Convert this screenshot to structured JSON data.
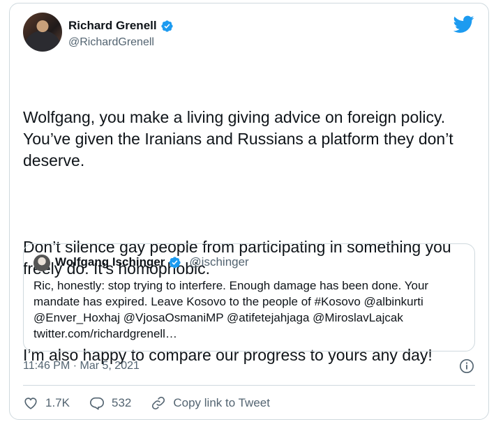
{
  "author": {
    "name": "Richard Grenell",
    "handle": "@RichardGrenell",
    "verified": true
  },
  "tweet": {
    "paragraphs": [
      "Wolfgang, you make a living giving advice on foreign policy. You’ve given the Iranians and Russians a platform they don’t deserve.",
      "Don’t silence gay people from participating in something you freely do. It’s homophobic.",
      "I’m also happy to compare our progress to yours any day!"
    ],
    "timestamp": "11:46 PM · Mar 5, 2021"
  },
  "quoted_tweet": {
    "name": "Wolfgang Ischinger",
    "handle": "@ischinger",
    "verified": true,
    "text": "Ric, honestly: stop trying to interfere. Enough damage has been done. Your mandate has expired. Leave Kosovo to the people of #Kosovo @albinkurti @Enver_Hoxhaj @VjosaOsmaniMP @atifetejahjaga @MiroslavLajcak twitter.com/richardgrenell…"
  },
  "actions": {
    "likes": "1.7K",
    "replies": "532",
    "copy_link": "Copy link to Tweet"
  },
  "colors": {
    "brand_blue": "#1d9bf0",
    "text_primary": "#0f1419",
    "text_secondary": "#536471",
    "border": "#cfd9de"
  },
  "icons": [
    "twitter-logo-icon",
    "verified-badge-icon",
    "info-icon",
    "heart-icon",
    "reply-icon",
    "link-icon"
  ]
}
